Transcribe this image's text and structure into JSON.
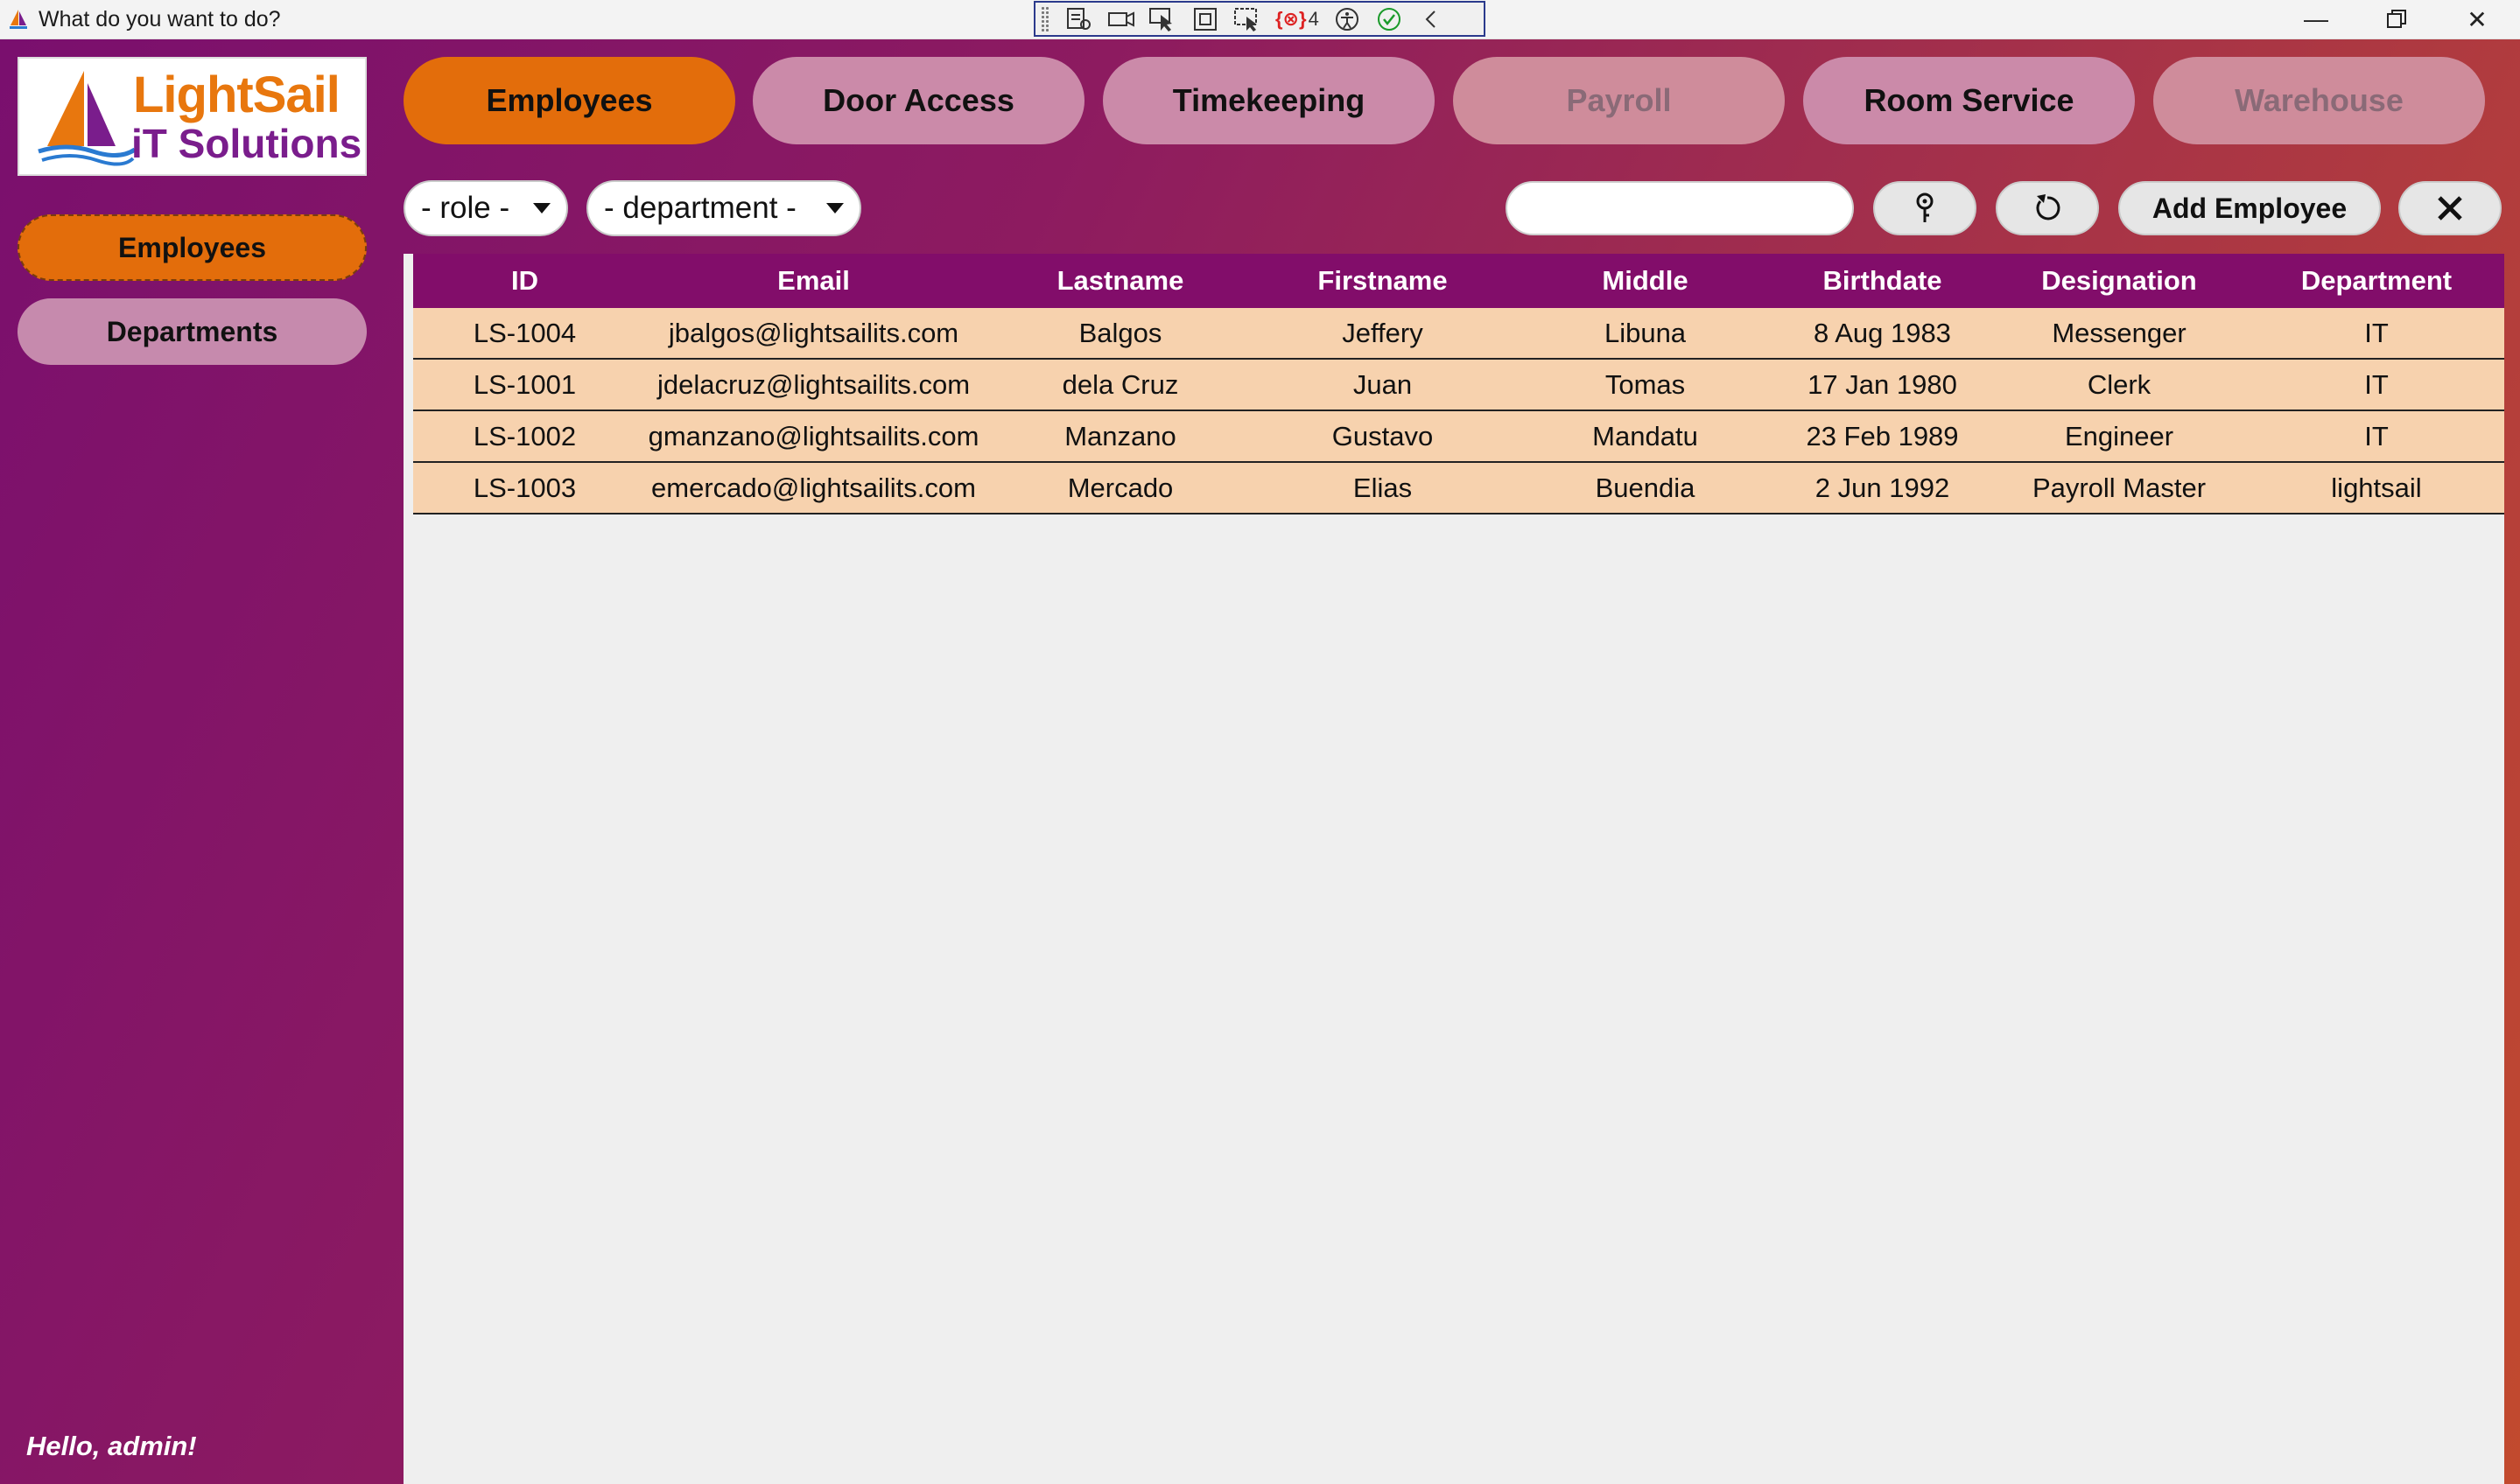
{
  "window": {
    "title": "What do you want to do?",
    "debug_badge_count": "4"
  },
  "logo": {
    "line1": "LightSail",
    "line2": "iT Solutions"
  },
  "sidebar": {
    "items": [
      {
        "label": "Employees",
        "state": "active"
      },
      {
        "label": "Departments",
        "state": "inactive"
      }
    ],
    "greeting": "Hello, admin!"
  },
  "tabs": [
    {
      "label": "Employees",
      "state": "active"
    },
    {
      "label": "Door Access",
      "state": "normal"
    },
    {
      "label": "Timekeeping",
      "state": "normal"
    },
    {
      "label": "Payroll",
      "state": "disabled"
    },
    {
      "label": "Room Service",
      "state": "normal"
    },
    {
      "label": "Warehouse",
      "state": "disabled"
    }
  ],
  "filters": {
    "role": "- role -",
    "department": "- department -",
    "search_value": ""
  },
  "actions": {
    "add_employee": "Add Employee"
  },
  "table": {
    "columns": [
      "ID",
      "Email",
      "Lastname",
      "Firstname",
      "Middle",
      "Birthdate",
      "Designation",
      "Department"
    ],
    "rows": [
      [
        "LS-1004",
        "jbalgos@lightsailits.com",
        "Balgos",
        "Jeffery",
        "Libuna",
        "8 Aug 1983",
        "Messenger",
        "IT"
      ],
      [
        "LS-1001",
        "jdelacruz@lightsailits.com",
        "dela Cruz",
        "Juan",
        "Tomas",
        "17 Jan 1980",
        "Clerk",
        "IT"
      ],
      [
        "LS-1002",
        "gmanzano@lightsailits.com",
        "Manzano",
        "Gustavo",
        "Mandatu",
        "23 Feb 1989",
        "Engineer",
        "IT"
      ],
      [
        "LS-1003",
        "emercado@lightsailits.com",
        "Mercado",
        "Elias",
        "Buendia",
        "2 Jun 1992",
        "Payroll Master",
        "lightsail"
      ]
    ]
  },
  "colors": {
    "accent": "#e36d0b",
    "header_purple": "#820d6a",
    "row_peach": "#f7d2ae"
  }
}
